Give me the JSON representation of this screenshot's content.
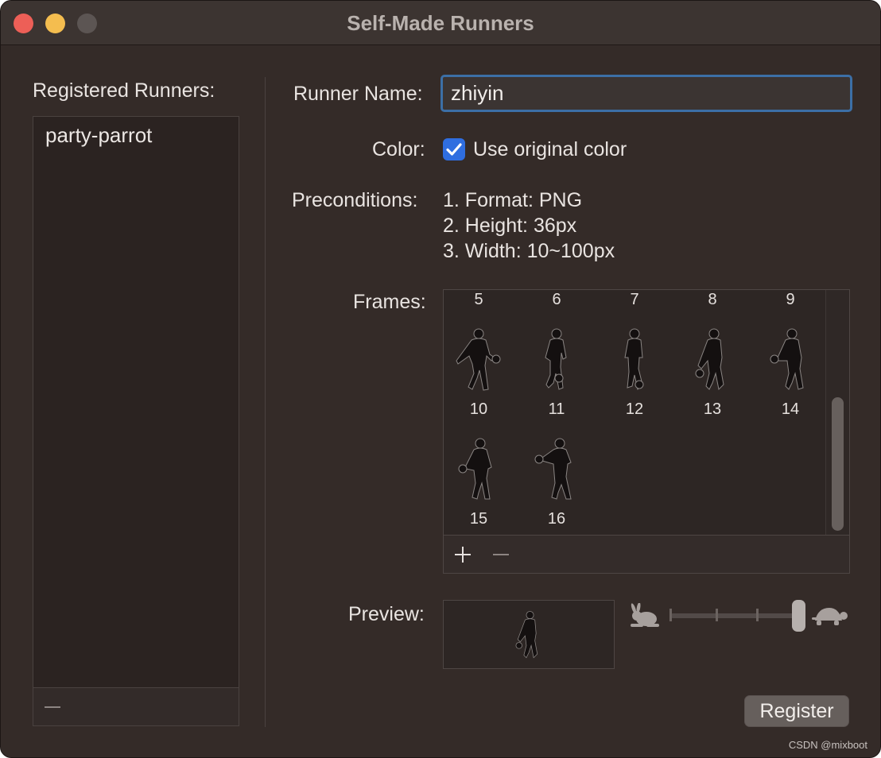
{
  "window": {
    "title": "Self-Made Runners"
  },
  "sidebar": {
    "heading": "Registered Runners:",
    "runners": [
      "party-parrot"
    ]
  },
  "form": {
    "runner_name_label": "Runner Name:",
    "runner_name_value": "zhiyin",
    "color_label": "Color:",
    "use_original_color_label": "Use original color",
    "use_original_color_checked": true,
    "preconditions_label": "Preconditions:",
    "preconditions": [
      "1. Format: PNG",
      "2. Height: 36px",
      "3. Width: 10~100px"
    ],
    "frames_label": "Frames:",
    "frames_top_row_numbers": [
      "5",
      "6",
      "7",
      "8",
      "9"
    ],
    "frames_row2_numbers": [
      "10",
      "11",
      "12",
      "13",
      "14"
    ],
    "frames_row3_numbers": [
      "15",
      "16"
    ],
    "preview_label": "Preview:",
    "speed_slider_fast_icon": "rabbit-icon",
    "speed_slider_slow_icon": "turtle-icon",
    "register_label": "Register"
  },
  "watermark": "CSDN @mixboot",
  "colors": {
    "accent": "#2f6ee0",
    "focus_ring": "#3c6fa6",
    "background": "#342b28"
  }
}
